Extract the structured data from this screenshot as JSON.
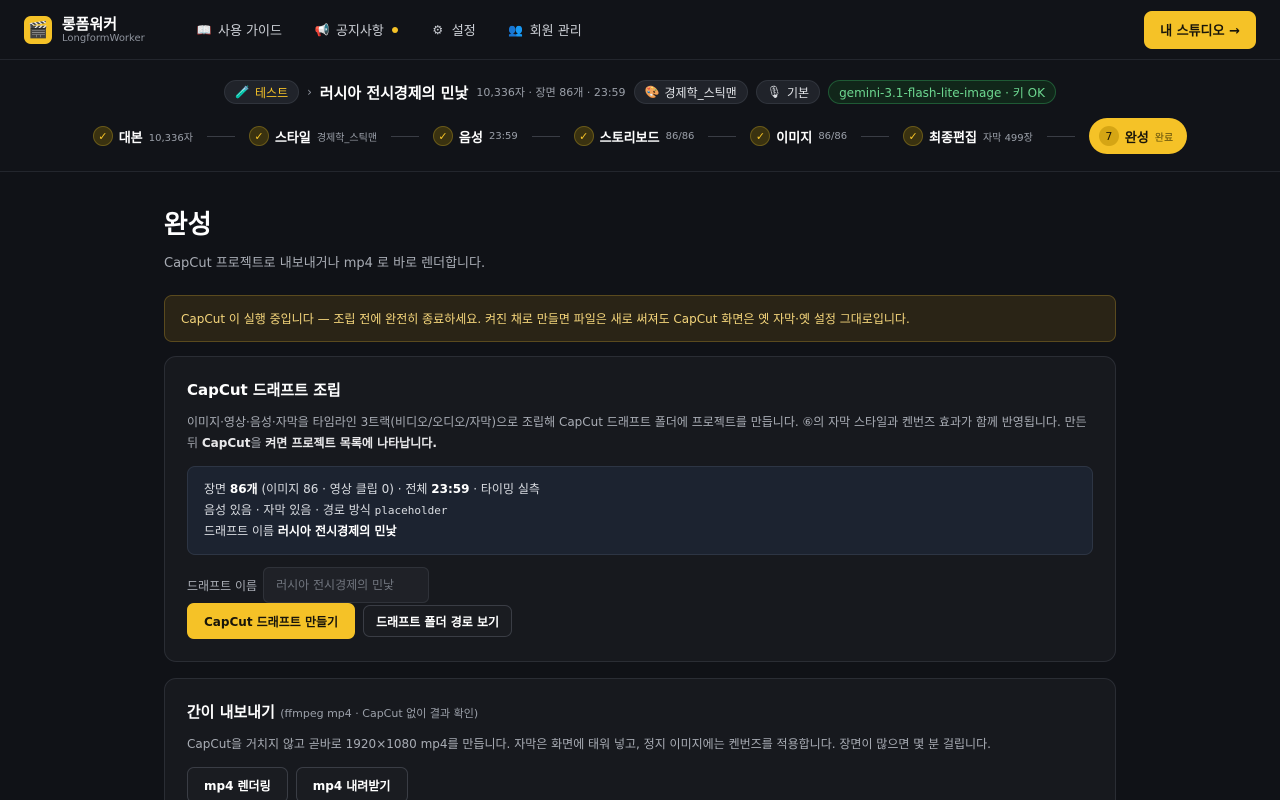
{
  "brand": {
    "name": "롱폼워커",
    "sub": "LongformWorker",
    "logo_icon": "🎬"
  },
  "nav": [
    {
      "icon": "📖",
      "label": "사용 가이드"
    },
    {
      "icon": "📢",
      "label": "공지사항",
      "dot": true
    },
    {
      "icon": "⚙",
      "label": "설정"
    },
    {
      "icon": "👥",
      "label": "회원 관리"
    }
  ],
  "studio_button": "내 스튜디오 →",
  "project": {
    "tag_icon": "🧪",
    "tag": "테스트",
    "crumb_sep": "›",
    "title": "러시아 전시경제의 민낯",
    "meta": "10,336자 · 장면 86개 · 23:59",
    "style_icon": "🎨",
    "style": "경제학_스틱맨",
    "voice_icon": "🎙",
    "voice": "기본",
    "model": "gemini-3.1-flash-lite-image · 키 OK"
  },
  "steps": [
    {
      "label": "대본",
      "sub": "10,336자"
    },
    {
      "label": "스타일",
      "sub": "경제학_스틱맨"
    },
    {
      "label": "음성",
      "sub": "23:59"
    },
    {
      "label": "스토리보드",
      "sub": "86/86"
    },
    {
      "label": "이미지",
      "sub": "86/86"
    },
    {
      "label": "최종편집",
      "sub": "자막 499장"
    }
  ],
  "active_step": {
    "num": "7",
    "label": "완성",
    "sub": "완료"
  },
  "check_icon": "✓",
  "page": {
    "title": "완성",
    "desc": "CapCut 프로젝트로 내보내거나 mp4 로 바로 렌더합니다.",
    "warning": "CapCut 이 실행 중입니다 — 조립 전에 완전히 종료하세요. 켜진 채로 만들면 파일은 새로 써져도 CapCut 화면은 옛 자막·옛 설정 그대로입니다."
  },
  "capcut": {
    "title": "CapCut 드래프트 조립",
    "desc_1": "이미지·영상·음성·자막을 타임라인 3트랙(비디오/오디오/자막)으로 조립해 CapCut 드래프트 폴더에 프로젝트를 만듭니다. ⑥의 자막 스타일과 켄번즈 효과가 함께 반영됩니다. 만든 뒤 ",
    "desc_b1": "CapCut",
    "desc_2": "을 ",
    "desc_b2": "켜면 프로젝트 목록에 나타납니다.",
    "s1_a": "장면 ",
    "s1_b": "86개",
    "s1_c": " (이미지 86 · 영상 클립 0) · 전체 ",
    "s1_d": "23:59",
    "s1_e": " · 타이밍 실측",
    "s2_a": "음성 있음 · 자막 있음 · 경로 방식 ",
    "s2_b": "placeholder",
    "s3_a": "드래프트 이름 ",
    "s3_b": "러시아 전시경제의 민낯",
    "field_label": "드래프트 이름",
    "field_placeholder": "러시아 전시경제의 민낯",
    "make_button": "CapCut 드래프트 만들기",
    "path_button": "드래프트 폴더 경로 보기"
  },
  "export": {
    "title": "간이 내보내기",
    "title_sub": "(ffmpeg mp4 · CapCut 없이 결과 확인)",
    "desc": "CapCut을 거치지 않고 곧바로 1920×1080 mp4를 만듭니다. 자막은 화면에 태워 넣고, 정지 이미지에는 켄번즈를 적용합니다. 장면이 많으면 몇 분 걸립니다.",
    "render_button": "mp4 렌더링",
    "download_button": "mp4 내려받기"
  },
  "colors": {
    "accent": "#f5c227",
    "background": "#101217",
    "ok": "#6cd68f"
  }
}
